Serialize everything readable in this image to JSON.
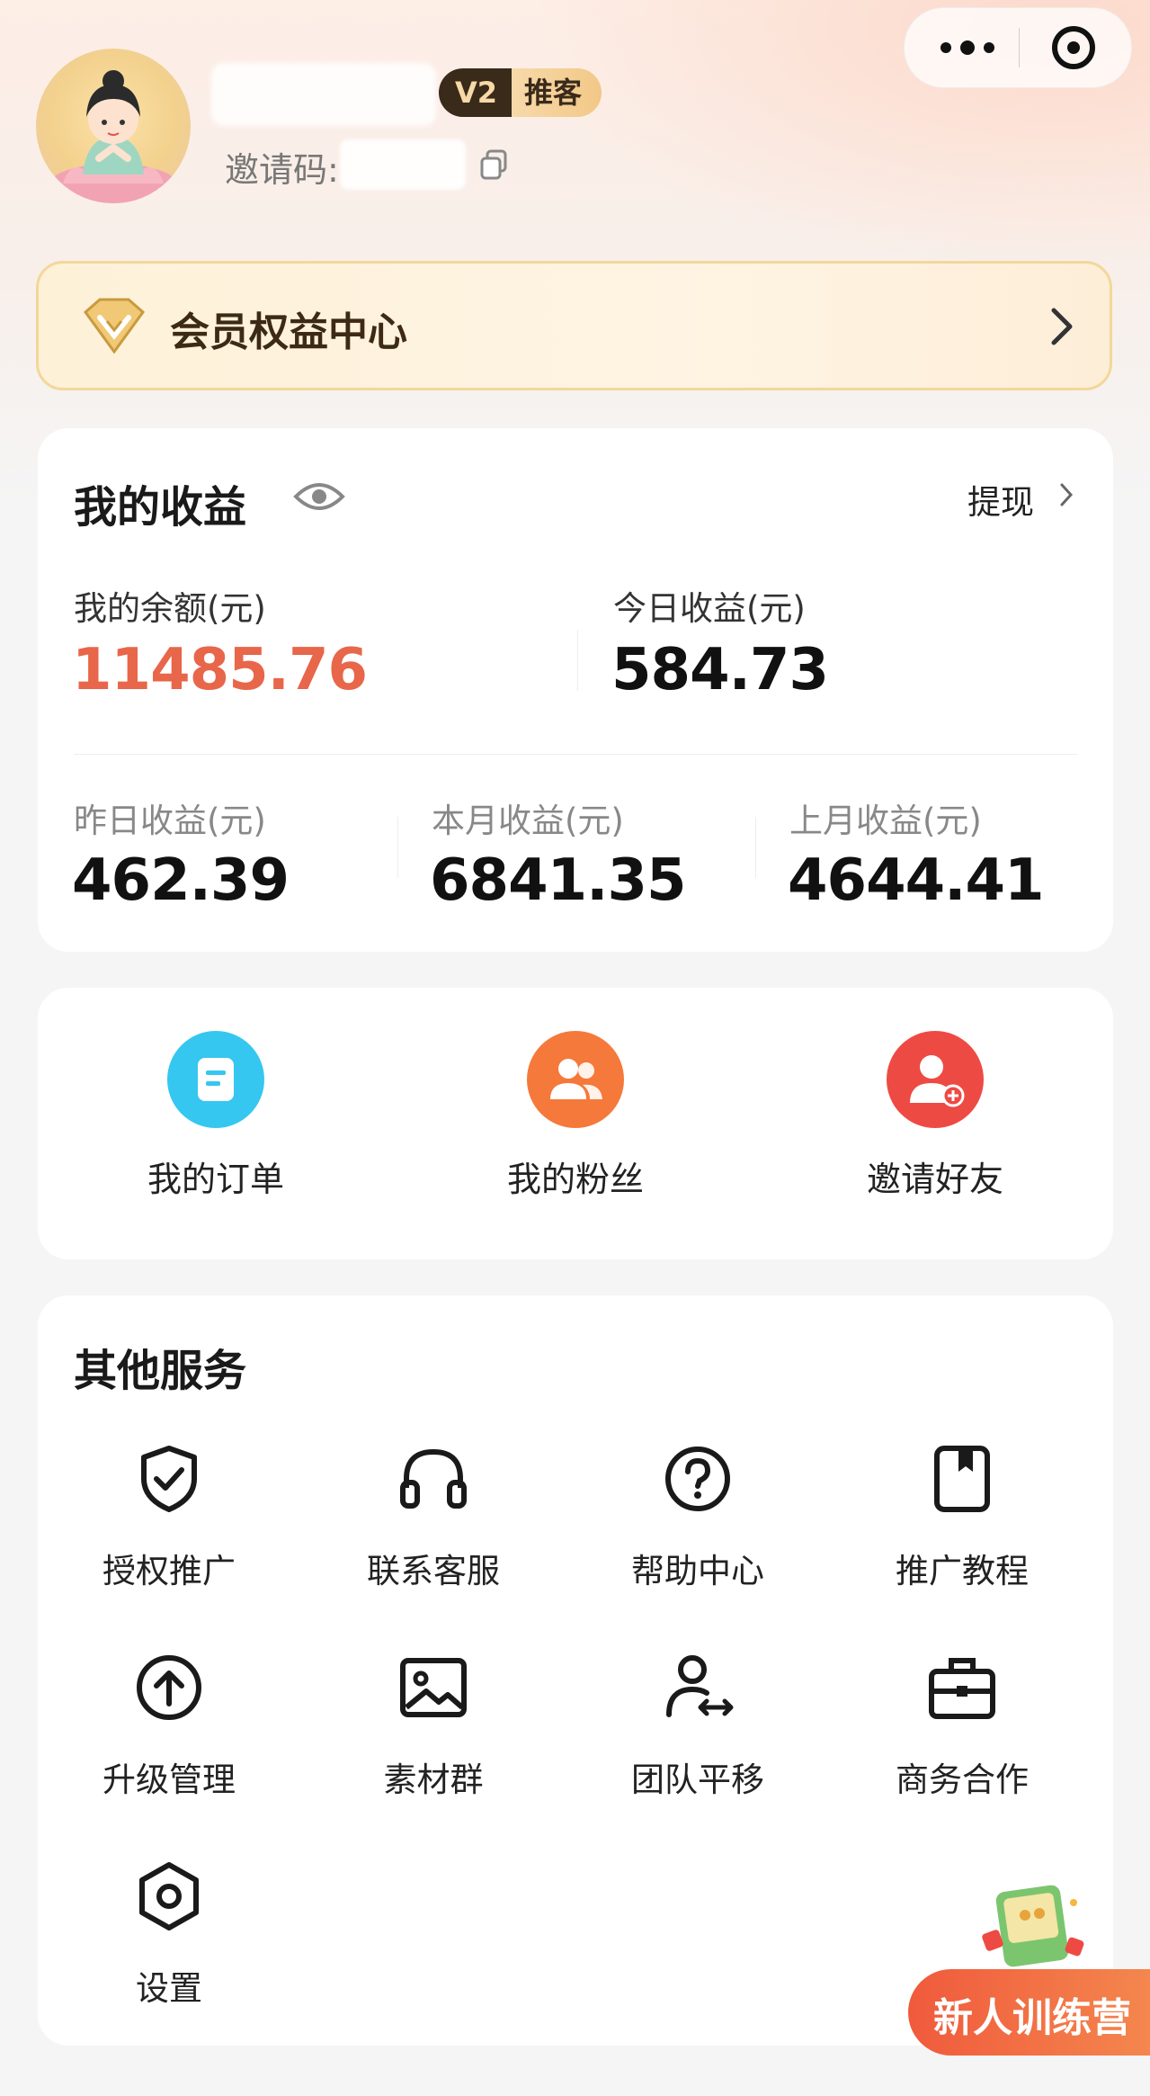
{
  "capsule": {
    "more_icon": "more-dots-icon",
    "close_icon": "target-circle-icon"
  },
  "profile": {
    "level_badge": "V2",
    "role_badge": "推客",
    "invite_label": "邀请码:"
  },
  "vip": {
    "title": "会员权益中心",
    "icon": "crown-badge-icon"
  },
  "earnings": {
    "title": "我的收益",
    "withdraw_label": "提现",
    "balance_label": "我的余额(元)",
    "balance_value": "11485.76",
    "today_label": "今日收益(元)",
    "today_value": "584.73",
    "yesterday_label": "昨日收益(元)",
    "yesterday_value": "462.39",
    "this_month_label": "本月收益(元)",
    "this_month_value": "6841.35",
    "last_month_label": "上月收益(元)",
    "last_month_value": "4644.41",
    "accent_color": "#e8664a"
  },
  "quick_actions": [
    {
      "label": "我的订单",
      "icon": "order-list-icon",
      "color": "#35c7f0"
    },
    {
      "label": "我的粉丝",
      "icon": "fans-users-icon",
      "color": "#f5793a"
    },
    {
      "label": "邀请好友",
      "icon": "invite-user-icon",
      "color": "#ee4a44"
    }
  ],
  "services": {
    "title": "其他服务",
    "items": [
      {
        "label": "授权推广",
        "icon": "shield-check-icon"
      },
      {
        "label": "联系客服",
        "icon": "headset-icon"
      },
      {
        "label": "帮助中心",
        "icon": "question-circle-icon"
      },
      {
        "label": "推广教程",
        "icon": "bookmark-book-icon"
      },
      {
        "label": "升级管理",
        "icon": "upgrade-arrow-icon"
      },
      {
        "label": "素材群",
        "icon": "image-icon"
      },
      {
        "label": "团队平移",
        "icon": "user-transfer-icon"
      },
      {
        "label": "商务合作",
        "icon": "briefcase-icon"
      },
      {
        "label": "设置",
        "icon": "settings-hexagon-icon"
      }
    ]
  },
  "training_camp": {
    "label": "新人训练营",
    "icon": "gift-book-icon"
  }
}
